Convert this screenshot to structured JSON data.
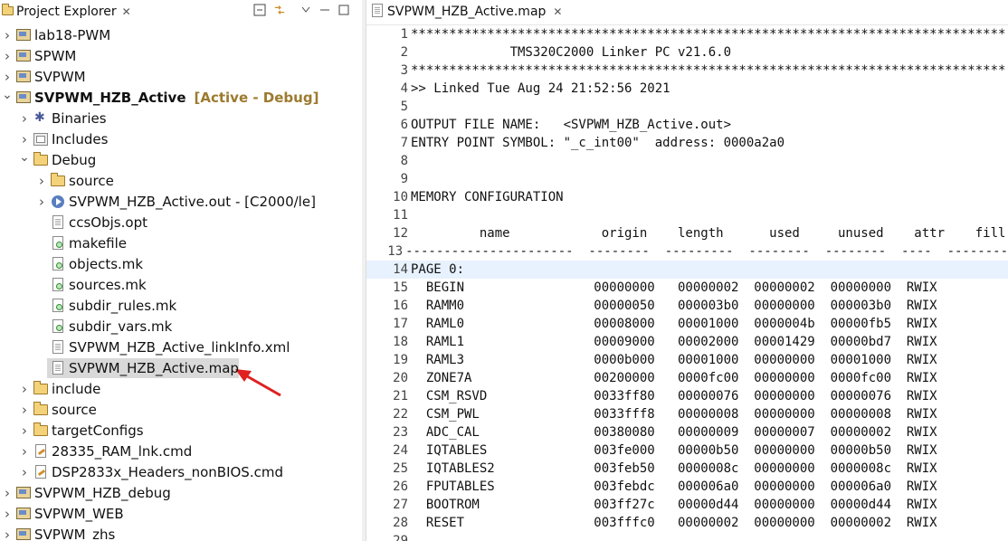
{
  "explorer": {
    "tab_title": "Project Explorer",
    "close_glyph": "✕",
    "tree": [
      {
        "depth": 0,
        "twisty": "collapsed",
        "icon": "project-icon",
        "label": "lab18-PWM"
      },
      {
        "depth": 0,
        "twisty": "collapsed",
        "icon": "project-icon",
        "label": "SPWM"
      },
      {
        "depth": 0,
        "twisty": "collapsed",
        "icon": "project-icon",
        "label": "SVPWM"
      },
      {
        "depth": 0,
        "twisty": "expanded",
        "icon": "project-icon",
        "label": "SVPWM_HZB_Active",
        "bold": true,
        "decoration": "[Active - Debug]"
      },
      {
        "depth": 1,
        "twisty": "collapsed",
        "icon": "binaries-icon",
        "label": "Binaries"
      },
      {
        "depth": 1,
        "twisty": "collapsed",
        "icon": "includes-icon",
        "label": "Includes"
      },
      {
        "depth": 1,
        "twisty": "expanded",
        "icon": "folder-icon",
        "label": "Debug"
      },
      {
        "depth": 2,
        "twisty": "collapsed",
        "icon": "folder-icon",
        "label": "source"
      },
      {
        "depth": 2,
        "twisty": "collapsed",
        "icon": "out-file-icon",
        "label": "SVPWM_HZB_Active.out - [C2000/le]"
      },
      {
        "depth": 2,
        "twisty": "none",
        "icon": "file-icon",
        "label": "ccsObjs.opt"
      },
      {
        "depth": 2,
        "twisty": "none",
        "icon": "makefile-icon",
        "label": "makefile"
      },
      {
        "depth": 2,
        "twisty": "none",
        "icon": "makefile-icon",
        "label": "objects.mk"
      },
      {
        "depth": 2,
        "twisty": "none",
        "icon": "makefile-icon",
        "label": "sources.mk"
      },
      {
        "depth": 2,
        "twisty": "none",
        "icon": "makefile-icon",
        "label": "subdir_rules.mk"
      },
      {
        "depth": 2,
        "twisty": "none",
        "icon": "makefile-icon",
        "label": "subdir_vars.mk"
      },
      {
        "depth": 2,
        "twisty": "none",
        "icon": "file-icon",
        "label": "SVPWM_HZB_Active_linkInfo.xml"
      },
      {
        "depth": 2,
        "twisty": "none",
        "icon": "file-icon",
        "label": "SVPWM_HZB_Active.map",
        "selected": true
      },
      {
        "depth": 1,
        "twisty": "collapsed",
        "icon": "folder-icon",
        "label": "include"
      },
      {
        "depth": 1,
        "twisty": "collapsed",
        "icon": "folder-icon",
        "label": "source"
      },
      {
        "depth": 1,
        "twisty": "collapsed",
        "icon": "folder-icon",
        "label": "targetConfigs"
      },
      {
        "depth": 1,
        "twisty": "collapsed",
        "icon": "cmd-file-icon",
        "label": "28335_RAM_lnk.cmd"
      },
      {
        "depth": 1,
        "twisty": "collapsed",
        "icon": "cmd-file-icon",
        "label": "DSP2833x_Headers_nonBIOS.cmd"
      },
      {
        "depth": 0,
        "twisty": "collapsed",
        "icon": "project-icon",
        "label": "SVPWM_HZB_debug"
      },
      {
        "depth": 0,
        "twisty": "collapsed",
        "icon": "project-icon",
        "label": "SVPWM_WEB"
      },
      {
        "depth": 0,
        "twisty": "collapsed",
        "icon": "project-icon",
        "label": "SVPWM_zhs"
      }
    ]
  },
  "editor": {
    "tab_title": "SVPWM_HZB_Active.map",
    "close_glyph": "✕",
    "highlighted_line": 14,
    "lines": [
      {
        "n": "1",
        "t": "******************************************************************************"
      },
      {
        "n": "2",
        "t": "             TMS320C2000 Linker PC v21.6.0"
      },
      {
        "n": "3",
        "t": "******************************************************************************"
      },
      {
        "n": "4",
        "t": ">> Linked Tue Aug 24 21:52:56 2021"
      },
      {
        "n": "5",
        "t": ""
      },
      {
        "n": "6",
        "t": "OUTPUT FILE NAME:   <SVPWM_HZB_Active.out>"
      },
      {
        "n": "7",
        "t": "ENTRY POINT SYMBOL: \"_c_int00\"  address: 0000a2a0"
      },
      {
        "n": "8",
        "t": ""
      },
      {
        "n": "9",
        "t": ""
      },
      {
        "n": "10",
        "t": "MEMORY CONFIGURATION"
      },
      {
        "n": "11",
        "t": ""
      },
      {
        "n": "12",
        "t": "         name            origin    length      used     unused    attr    fill"
      },
      {
        "n": "13",
        "t": "----------------------  --------  ---------  --------  --------  ----  --------"
      },
      {
        "n": "14",
        "t": "PAGE 0:"
      },
      {
        "n": "15",
        "t": "  BEGIN                 00000000   00000002  00000002  00000000  RWIX"
      },
      {
        "n": "16",
        "t": "  RAMM0                 00000050   000003b0  00000000  000003b0  RWIX"
      },
      {
        "n": "17",
        "t": "  RAML0                 00008000   00001000  0000004b  00000fb5  RWIX"
      },
      {
        "n": "18",
        "t": "  RAML1                 00009000   00002000  00001429  00000bd7  RWIX"
      },
      {
        "n": "19",
        "t": "  RAML3                 0000b000   00001000  00000000  00001000  RWIX"
      },
      {
        "n": "20",
        "t": "  ZONE7A                00200000   0000fc00  00000000  0000fc00  RWIX"
      },
      {
        "n": "21",
        "t": "  CSM_RSVD              0033ff80   00000076  00000000  00000076  RWIX"
      },
      {
        "n": "22",
        "t": "  CSM_PWL               0033fff8   00000008  00000000  00000008  RWIX"
      },
      {
        "n": "23",
        "t": "  ADC_CAL               00380080   00000009  00000007  00000002  RWIX"
      },
      {
        "n": "24",
        "t": "  IQTABLES              003fe000   00000b50  00000000  00000b50  RWIX"
      },
      {
        "n": "25",
        "t": "  IQTABLES2             003feb50   0000008c  00000000  0000008c  RWIX"
      },
      {
        "n": "26",
        "t": "  FPUTABLES             003febdc   000006a0  00000000  000006a0  RWIX"
      },
      {
        "n": "27",
        "t": "  BOOTROM               003ff27c   00000d44  00000000  00000d44  RWIX"
      },
      {
        "n": "28",
        "t": "  RESET                 003fffc0   00000002  00000000  00000002  RWIX"
      },
      {
        "n": "29",
        "t": ""
      }
    ]
  },
  "colors": {
    "selection_bg": "#d9d9d9",
    "line_highlight": "#e8f2fe",
    "decoration": "#9c7a2e",
    "arrow": "#e02020"
  }
}
